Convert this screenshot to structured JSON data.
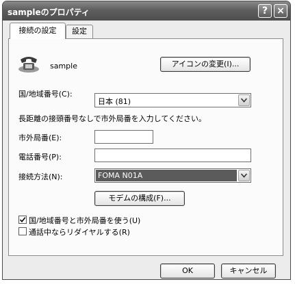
{
  "window": {
    "title": "sampleのプロパティ",
    "help_button": "?",
    "close_button": "×"
  },
  "tabs": [
    {
      "label": "接続の設定",
      "active": true
    },
    {
      "label": "設定",
      "active": false
    }
  ],
  "connection": {
    "name": "sample",
    "change_icon_button": "アイコンの変更(I)..."
  },
  "country": {
    "label": "国/地域番号(C):",
    "value": "日本 (81)"
  },
  "instruction": "長距離の接頭番号なしで市外局番を入力してください。",
  "area_code": {
    "label": "市外局番(E):",
    "value": ""
  },
  "phone_number": {
    "label": "電話番号(P):",
    "value": ""
  },
  "connect_using": {
    "label": "接続方法(N):",
    "value": "FOMA N01A"
  },
  "modem_config_button": "モデムの構成(F)...",
  "checkboxes": [
    {
      "label": "国/地域番号と市外局番を使う(U)",
      "checked": true
    },
    {
      "label": "通話中ならリダイヤルする(R)",
      "checked": false
    }
  ],
  "footer": {
    "ok": "OK",
    "cancel": "キャンセル"
  }
}
